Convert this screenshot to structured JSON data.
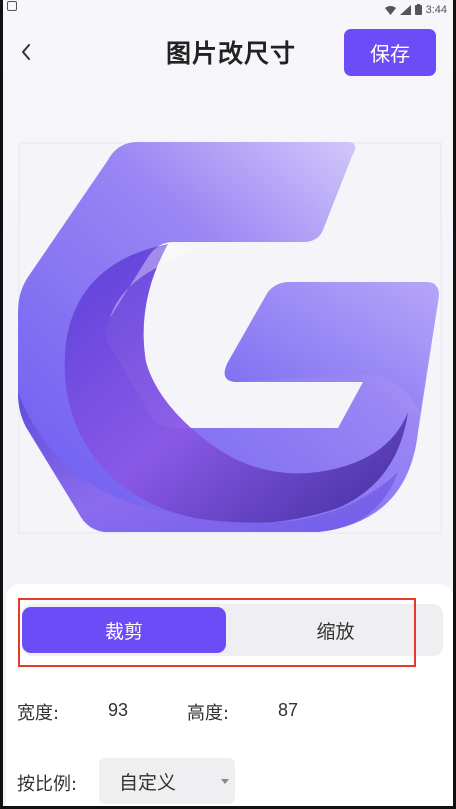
{
  "status_bar": {
    "time": "3:44",
    "icons": [
      "wifi-icon",
      "signal-icon",
      "battery-icon"
    ]
  },
  "header": {
    "back_icon": "chevron-left-icon",
    "title": "图片改尺寸",
    "save_label": "保存"
  },
  "image": {
    "description_icon": "g-logo-image"
  },
  "tabs": {
    "crop_label": "裁剪",
    "scale_label": "缩放",
    "active": "crop"
  },
  "dimensions": {
    "width_label": "宽度:",
    "width_value": "93",
    "height_label": "高度:",
    "height_value": "87"
  },
  "ratio": {
    "label": "按比例:",
    "selected": "自定义"
  },
  "colors": {
    "accent": "#6c4cf6",
    "highlight_outline": "#e53a26",
    "track": "#efeff2"
  }
}
